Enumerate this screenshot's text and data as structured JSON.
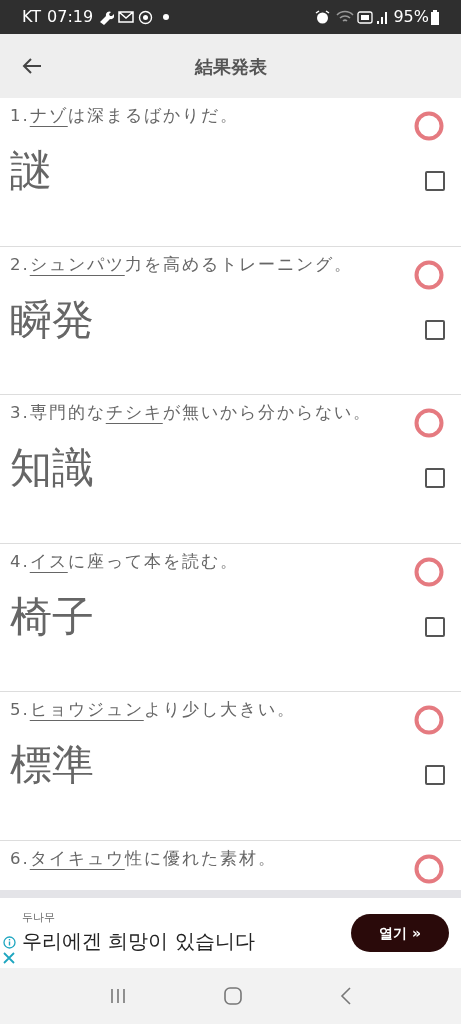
{
  "status_bar": {
    "carrier": "KT",
    "time": "07:19",
    "battery": "95%"
  },
  "header": {
    "title": "結果発表"
  },
  "items": [
    {
      "number": "1.",
      "reading": "ナゾ",
      "rest": "は深まるばかりだ。",
      "answer": "謎",
      "correct": true,
      "checked": false
    },
    {
      "number": "2.",
      "reading": "シュンパツ",
      "rest": "力を高めるトレーニング。",
      "answer": "瞬発",
      "correct": true,
      "checked": false
    },
    {
      "number": "3.",
      "pre": "専門的な",
      "reading": "チシキ",
      "rest": "が無いから分からない。",
      "answer": "知識",
      "correct": true,
      "checked": false
    },
    {
      "number": "4.",
      "reading": "イス",
      "rest": "に座って本を読む。",
      "answer": "椅子",
      "correct": true,
      "checked": false
    },
    {
      "number": "5.",
      "reading": "ヒョウジュン",
      "rest": "より少し大きい。",
      "answer": "標準",
      "correct": true,
      "checked": false
    },
    {
      "number": "6.",
      "reading": "タイキュウ",
      "rest": "性に優れた素材。",
      "correct": true
    }
  ],
  "ad": {
    "brand": "두나무",
    "headline": "우리에겐 희망이 있습니다",
    "button": "열기 »"
  }
}
